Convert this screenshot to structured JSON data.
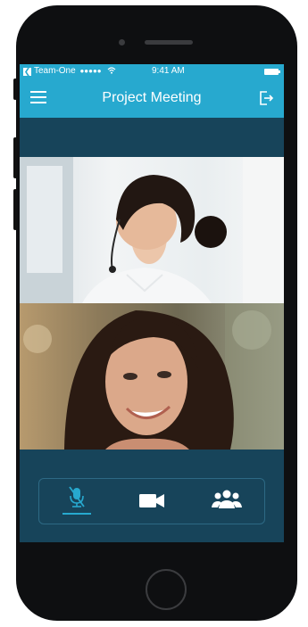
{
  "status_bar": {
    "carrier": "Team-One",
    "signal": "●●●●●",
    "time": "9:41 AM"
  },
  "nav": {
    "title": "Project Meeting"
  },
  "controls": [
    {
      "name": "mic-muted",
      "active": true
    },
    {
      "name": "video",
      "active": false
    },
    {
      "name": "participants",
      "active": false
    }
  ],
  "colors": {
    "accent": "#27a9cf",
    "screen_bg": "#17445a",
    "frame": "#0e0f11"
  },
  "icons": [
    "back-arrow-icon",
    "wifi-icon",
    "battery-icon",
    "hamburger-menu-icon",
    "exit-icon",
    "microphone-off-icon",
    "video-camera-icon",
    "group-icon"
  ]
}
